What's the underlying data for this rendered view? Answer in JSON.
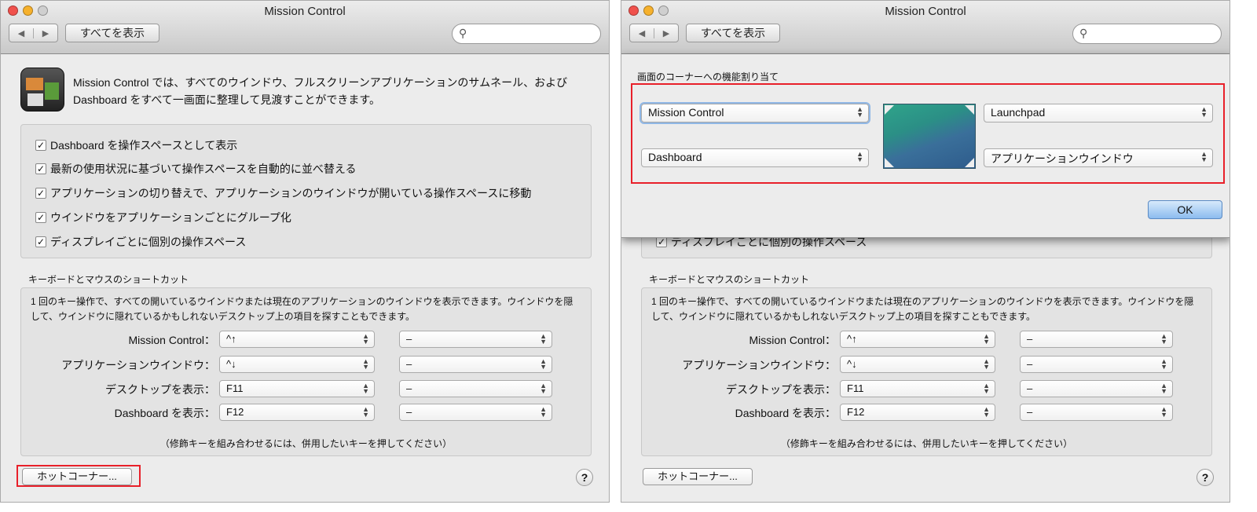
{
  "window": {
    "title": "Mission Control",
    "show_all": "すべてを表示",
    "search_placeholder": ""
  },
  "description": "Mission Control では、すべてのウインドウ、フルスクリーンアプリケーションのサムネール、および Dashboard をすべて一画面に整理して見渡すことができます。",
  "options": [
    {
      "label": "Dashboard を操作スペースとして表示",
      "checked": true
    },
    {
      "label": "最新の使用状況に基づいて操作スペースを自動的に並べ替える",
      "checked": true
    },
    {
      "label": "アプリケーションの切り替えで、アプリケーションのウインドウが開いている操作スペースに移動",
      "checked": true
    },
    {
      "label": "ウインドウをアプリケーションごとにグループ化",
      "checked": true
    },
    {
      "label": "ディスプレイごとに個別の操作スペース",
      "checked": true
    }
  ],
  "shortcuts": {
    "section_label": "キーボードとマウスのショートカット",
    "description": "1 回のキー操作で、すべての開いているウインドウまたは現在のアプリケーションのウインドウを表示できます。ウインドウを隠して、ウインドウに隠れているかもしれないデスクトップ上の項目を探すこともできます。",
    "rows": [
      {
        "label": "Mission Control：",
        "key": "^↑",
        "mouse": "–"
      },
      {
        "label": "アプリケーションウインドウ：",
        "key": "^↓",
        "mouse": "–"
      },
      {
        "label": "デスクトップを表示：",
        "key": "F11",
        "mouse": "–"
      },
      {
        "label": "Dashboard を表示：",
        "key": "F12",
        "mouse": "–"
      }
    ],
    "note": "（修飾キーを組み合わせるには、併用したいキーを押してください）"
  },
  "hot_corners_button": "ホットコーナー...",
  "help": "?",
  "sheet": {
    "title": "画面のコーナーへの機能割り当て",
    "top_left": "Mission Control",
    "top_right": "Launchpad",
    "bottom_left": "Dashboard",
    "bottom_right": "アプリケーションウインドウ",
    "ok": "OK"
  },
  "colors": {
    "highlight": "#e8202a",
    "ok_button": "#8cbcef"
  }
}
